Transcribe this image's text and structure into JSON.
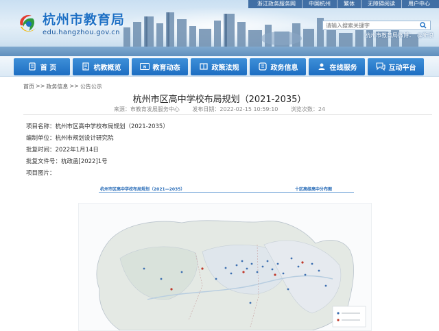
{
  "top_links": [
    "浙江政务服务网",
    "中国杭州",
    "繁体",
    "无障碍阅读",
    "用户中心"
  ],
  "logo": {
    "title": "杭州市教育局",
    "url": "edu.hangzhou.gov.cn"
  },
  "search": {
    "placeholder": "请输入搜索关键字"
  },
  "weibo": {
    "label": "杭州市教育局微博：",
    "link": "@新浪"
  },
  "nav": [
    {
      "label": "首  页",
      "icon": "home-icon"
    },
    {
      "label": "杭教概览",
      "icon": "document-icon"
    },
    {
      "label": "教育动态",
      "icon": "news-icon"
    },
    {
      "label": "政策法规",
      "icon": "book-icon"
    },
    {
      "label": "政务信息",
      "icon": "info-icon"
    },
    {
      "label": "在线服务",
      "icon": "user-service-icon"
    },
    {
      "label": "互动平台",
      "icon": "chat-icon"
    }
  ],
  "breadcrumb": {
    "home": "首页",
    "section": "政务信息",
    "sub": "公告公示",
    "sep": ">>"
  },
  "article": {
    "title": "杭州市区高中学校布局规划（2021-2035）",
    "source": "来源：市教育发展服务中心",
    "published": "发布日期：2022-02-15 10:59:10",
    "views": "浏览次数：24"
  },
  "fields": [
    "项目名称：杭州市区高中学校布局规划（2021-2035）",
    "编制单位：杭州市规划设计研究院",
    "批复时间：2022年1月14日",
    "批复文件号：杭政函[2022]1号",
    "项目图片："
  ],
  "map": {
    "title_left": "杭州市区高中学校布局规划（2021—2035）",
    "title_right": "十区高级高中分布图"
  },
  "colors": {
    "nav_blue": "#1d6ec2",
    "brand_blue": "#1c6fc4"
  }
}
